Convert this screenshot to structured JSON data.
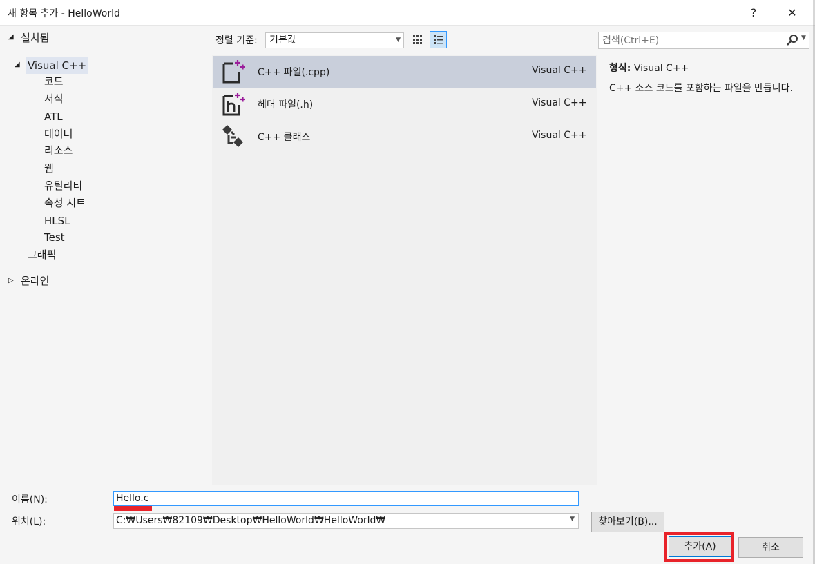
{
  "window": {
    "title": "새 항목 추가 - HelloWorld",
    "help_label": "?",
    "close_label": "✕"
  },
  "tree": {
    "installed": {
      "arrow": "◢",
      "label": "설치됨"
    },
    "visual_cpp": {
      "arrow": "◢",
      "label": "Visual C++"
    },
    "children": [
      "코드",
      "서식",
      "ATL",
      "데이터",
      "리소스",
      "웹",
      "유틸리티",
      "속성 시트",
      "HLSL",
      "Test"
    ],
    "graphics": {
      "label": "그래픽"
    },
    "online": {
      "arrow": "▷",
      "label": "온라인"
    }
  },
  "toolbar": {
    "sort_label": "정렬 기준:",
    "sort_value": "기본값",
    "small_icons_view": "small-icons-grid-icon",
    "list_view": "list-details-icon"
  },
  "search": {
    "placeholder": "검색(Ctrl+E)",
    "icon": "search-icon"
  },
  "items": [
    {
      "name": "C++ 파일(.cpp)",
      "lang": "Visual C++",
      "icon": "cpp-file-icon",
      "selected": true
    },
    {
      "name": "헤더 파일(.h)",
      "lang": "Visual C++",
      "icon": "header-file-icon",
      "selected": false
    },
    {
      "name": "C++ 클래스",
      "lang": "Visual C++",
      "icon": "cpp-class-icon",
      "selected": false
    }
  ],
  "details": {
    "type_label": "형식:",
    "type_value": "Visual C++",
    "description": "C++ 소스 코드를 포함하는 파일을 만듭니다."
  },
  "form": {
    "name_label": "이름(N):",
    "name_value": "Hello.c",
    "location_label": "위치(L):",
    "location_value": "C:₩Users₩82109₩Desktop₩HelloWorld₩HelloWorld₩",
    "browse_label": "찾아보기(B)...",
    "add_label": "추가(A)",
    "cancel_label": "취소"
  },
  "colors": {
    "highlight": "#e8232a",
    "selected_item": "#c9cfdb",
    "focus": "#3399ff"
  }
}
